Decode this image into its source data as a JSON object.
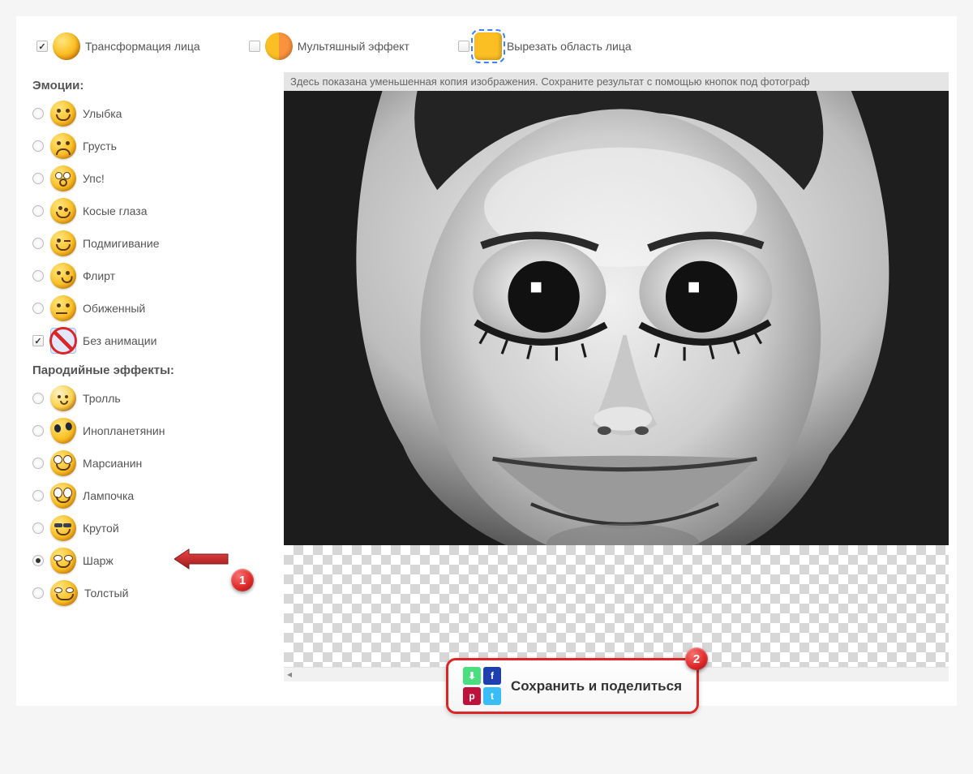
{
  "top": {
    "transform": "Трансформация лица",
    "cartoon": "Мультяшный эффект",
    "crop": "Вырезать область лица"
  },
  "sections": {
    "emotions": "Эмоции:",
    "parody": "Пародийные эффекты:"
  },
  "emotions": {
    "smile": "Улыбка",
    "sad": "Грусть",
    "oops": "Упс!",
    "crosseyed": "Косые глаза",
    "wink": "Подмигивание",
    "flirt": "Флирт",
    "offended": "Обиженный",
    "noanim": "Без анимации"
  },
  "parody": {
    "troll": "Тролль",
    "alien": "Инопланетянин",
    "martian": "Марсианин",
    "bulb": "Лампочка",
    "cool": "Крутой",
    "caricature": "Шарж",
    "fat": "Толстый"
  },
  "hint": "Здесь показана уменьшенная копия изображения. Сохраните результат с помощью кнопок под фотограф",
  "save_label": "Сохранить и поделиться",
  "badges": {
    "one": "1",
    "two": "2"
  }
}
